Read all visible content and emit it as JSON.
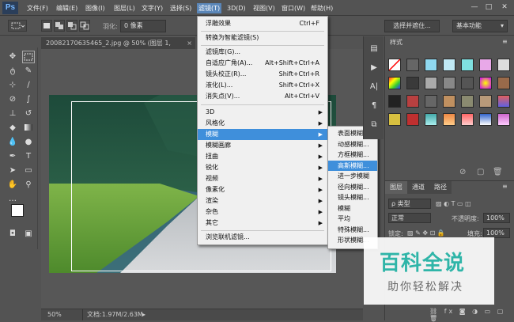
{
  "app": {
    "logo": "Ps"
  },
  "menubar": {
    "items": [
      "文件(F)",
      "编辑(E)",
      "图像(I)",
      "图层(L)",
      "文字(Y)",
      "选择(S)",
      "滤镜(T)",
      "3D(D)",
      "视图(V)",
      "窗口(W)",
      "帮助(H)"
    ],
    "window_controls": [
      "—",
      "□",
      "✕"
    ]
  },
  "options": {
    "feather_label": "羽化:",
    "feather_value": "0 像素",
    "refine_button": "选择并遮住...",
    "workspace": "基本功能"
  },
  "document": {
    "tab_title": "20082170635465_2.jpg @ 50% (图层 1, RGB/8#) *",
    "close": "×",
    "zoom": "50%",
    "doc_info": "文档:1.97M/2.63M"
  },
  "filter_menu": {
    "items": [
      {
        "label": "浮雕效果",
        "shortcut": "Ctrl+F"
      },
      {
        "label": "转换为智能滤镜(S)",
        "shortcut": ""
      },
      {
        "label": "滤镜库(G)...",
        "shortcut": ""
      },
      {
        "label": "自适应广角(A)...",
        "shortcut": "Alt+Shift+Ctrl+A"
      },
      {
        "label": "镜头校正(R)...",
        "shortcut": "Shift+Ctrl+R"
      },
      {
        "label": "液化(L)...",
        "shortcut": "Shift+Ctrl+X"
      },
      {
        "label": "消失点(V)...",
        "shortcut": "Alt+Ctrl+V"
      },
      {
        "label": "3D",
        "shortcut": ""
      },
      {
        "label": "风格化",
        "shortcut": ""
      },
      {
        "label": "模糊",
        "shortcut": ""
      },
      {
        "label": "模糊画廊",
        "shortcut": ""
      },
      {
        "label": "扭曲",
        "shortcut": ""
      },
      {
        "label": "锐化",
        "shortcut": ""
      },
      {
        "label": "视频",
        "shortcut": ""
      },
      {
        "label": "像素化",
        "shortcut": ""
      },
      {
        "label": "渲染",
        "shortcut": ""
      },
      {
        "label": "杂色",
        "shortcut": ""
      },
      {
        "label": "其它",
        "shortcut": ""
      },
      {
        "label": "浏览联机滤镜...",
        "shortcut": ""
      }
    ]
  },
  "blur_menu": {
    "items": [
      "表面模糊...",
      "动感模糊...",
      "方框模糊...",
      "高斯模糊...",
      "进一步模糊",
      "径向模糊...",
      "镜头模糊...",
      "模糊",
      "平均",
      "特殊模糊...",
      "形状模糊..."
    ]
  },
  "panels": {
    "swatches_tab": "样式",
    "layers_tabs": [
      "图层",
      "通道",
      "路径"
    ],
    "kind_label": "ρ 类型",
    "blend_mode": "正常",
    "opacity_label": "不透明度:",
    "opacity_value": "100%",
    "lock_label": "锁定:",
    "fill_label": "填充:",
    "fill_value": "100%"
  },
  "watermark": {
    "title": "百科全说",
    "subtitle": "助你轻松解决"
  }
}
